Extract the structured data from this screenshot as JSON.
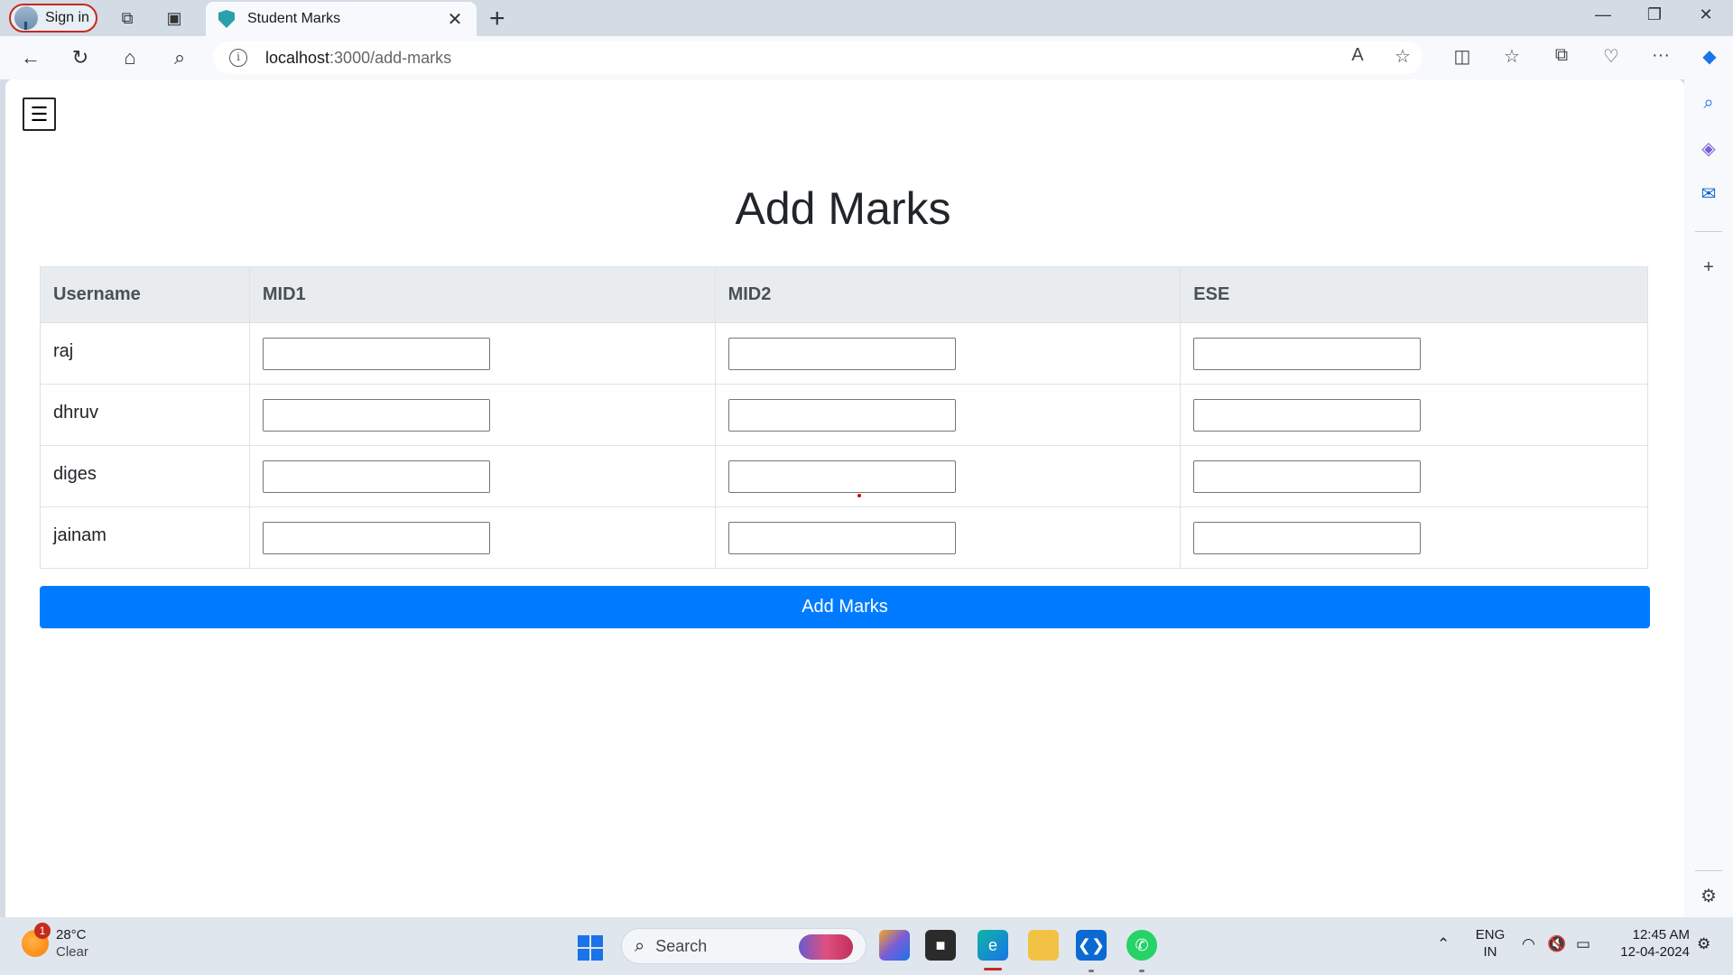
{
  "browser": {
    "signin_label": "Sign in",
    "tab_title": "Student Marks",
    "url_host": "localhost",
    "url_path": ":3000/add-marks"
  },
  "page": {
    "menu_glyph": "☰",
    "title": "Add Marks",
    "table": {
      "headers": [
        "Username",
        "MID1",
        "MID2",
        "ESE"
      ],
      "rows": [
        {
          "username": "raj",
          "mid1": "",
          "mid2": "",
          "ese": ""
        },
        {
          "username": "dhruv",
          "mid1": "",
          "mid2": "",
          "ese": ""
        },
        {
          "username": "diges",
          "mid1": "",
          "mid2": "",
          "ese": ""
        },
        {
          "username": "jainam",
          "mid1": "",
          "mid2": "",
          "ese": ""
        }
      ]
    },
    "submit_label": "Add Marks"
  },
  "taskbar": {
    "weather_temp": "28°C",
    "weather_desc": "Clear",
    "weather_badge": "1",
    "search_label": "Search",
    "lang_line1": "ENG",
    "lang_line2": "IN",
    "time": "12:45 AM",
    "date": "12-04-2024"
  },
  "colors": {
    "primary": "#007bff",
    "header_bg": "#e9ecef",
    "signin_border": "#c42b1c"
  }
}
